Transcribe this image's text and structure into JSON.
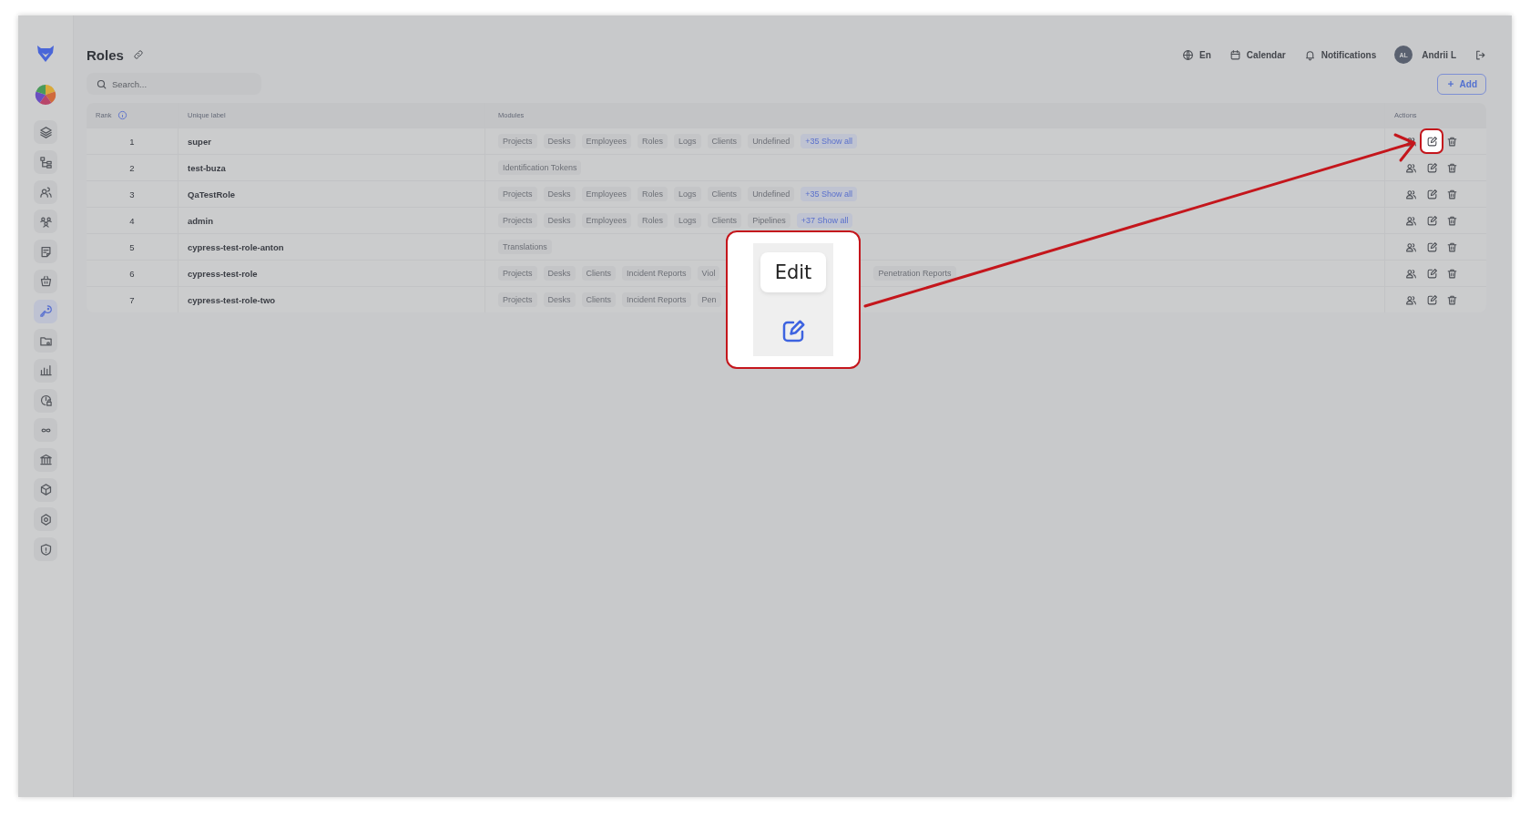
{
  "sidebar": {
    "items": [
      {
        "selected": false
      },
      {
        "selected": false
      },
      {
        "selected": false
      },
      {
        "selected": false
      },
      {
        "selected": false
      },
      {
        "selected": false
      },
      {
        "selected": true
      },
      {
        "selected": false
      },
      {
        "selected": false
      },
      {
        "selected": false
      },
      {
        "selected": false
      },
      {
        "selected": false
      },
      {
        "selected": false
      },
      {
        "selected": false
      },
      {
        "selected": false
      }
    ]
  },
  "header": {
    "title": "Roles",
    "language": "En",
    "calendar": "Calendar",
    "notifications": "Notifications",
    "user": {
      "initials": "AL",
      "name": "Andrii L"
    }
  },
  "search": {
    "placeholder": "Search..."
  },
  "add_button": "Add",
  "table": {
    "columns": [
      "Rank",
      "Unique label",
      "Modules",
      "Actions"
    ],
    "rows": [
      {
        "rank": "1",
        "label": "super",
        "highlighted": true,
        "modules": [
          {
            "text": "Projects",
            "kind": "module"
          },
          {
            "text": "Desks",
            "kind": "module"
          },
          {
            "text": "Employees",
            "kind": "module"
          },
          {
            "text": "Roles",
            "kind": "module"
          },
          {
            "text": "Logs",
            "kind": "module"
          },
          {
            "text": "Clients",
            "kind": "module"
          },
          {
            "text": "Undefined",
            "kind": "module"
          },
          {
            "text": "+35 Show all",
            "kind": "more"
          }
        ]
      },
      {
        "rank": "2",
        "label": "test-buza",
        "highlighted": false,
        "modules": [
          {
            "text": "Identification Tokens",
            "kind": "module"
          }
        ]
      },
      {
        "rank": "3",
        "label": "QaTestRole",
        "highlighted": false,
        "modules": [
          {
            "text": "Projects",
            "kind": "module"
          },
          {
            "text": "Desks",
            "kind": "module"
          },
          {
            "text": "Employees",
            "kind": "module"
          },
          {
            "text": "Roles",
            "kind": "module"
          },
          {
            "text": "Logs",
            "kind": "module"
          },
          {
            "text": "Clients",
            "kind": "module"
          },
          {
            "text": "Undefined",
            "kind": "module"
          },
          {
            "text": "+35 Show all",
            "kind": "more"
          }
        ]
      },
      {
        "rank": "4",
        "label": "admin",
        "highlighted": false,
        "modules": [
          {
            "text": "Projects",
            "kind": "module"
          },
          {
            "text": "Desks",
            "kind": "module"
          },
          {
            "text": "Employees",
            "kind": "module"
          },
          {
            "text": "Roles",
            "kind": "module"
          },
          {
            "text": "Logs",
            "kind": "module"
          },
          {
            "text": "Clients",
            "kind": "module"
          },
          {
            "text": "Pipelines",
            "kind": "module"
          },
          {
            "text": "+37 Show all",
            "kind": "more"
          }
        ]
      },
      {
        "rank": "5",
        "label": "cypress-test-role-anton",
        "highlighted": false,
        "modules": [
          {
            "text": "Translations",
            "kind": "module"
          }
        ]
      },
      {
        "rank": "6",
        "label": "cypress-test-role",
        "highlighted": false,
        "modules": [
          {
            "text": "Projects",
            "kind": "module"
          },
          {
            "text": "Desks",
            "kind": "module"
          },
          {
            "text": "Clients",
            "kind": "module"
          },
          {
            "text": "Incident Reports",
            "kind": "module"
          },
          {
            "text": "Viol",
            "kind": "partial"
          },
          {
            "text": "Penetration Reports",
            "kind": "module"
          }
        ]
      },
      {
        "rank": "7",
        "label": "cypress-test-role-two",
        "highlighted": false,
        "modules": [
          {
            "text": "Projects",
            "kind": "module"
          },
          {
            "text": "Desks",
            "kind": "module"
          },
          {
            "text": "Clients",
            "kind": "module"
          },
          {
            "text": "Incident Reports",
            "kind": "module"
          },
          {
            "text": "Pen",
            "kind": "partial"
          }
        ]
      }
    ]
  },
  "callout": {
    "tooltip": "Edit"
  }
}
